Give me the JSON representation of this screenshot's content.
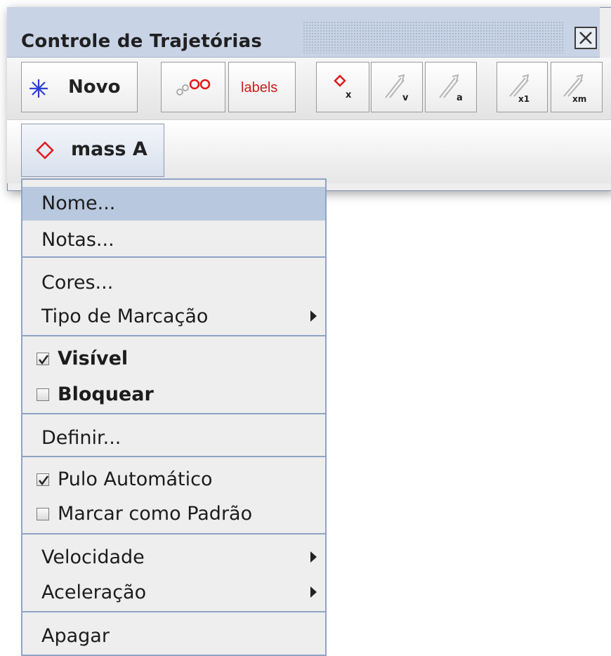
{
  "window": {
    "title": "Controle de Trajetórias",
    "close_icon": "close-icon"
  },
  "toolbar": {
    "new_label": "Novo",
    "new_icon": "asterisk-icon",
    "labels_label": "labels",
    "buttons": [
      {
        "icon": "track-points-icon"
      },
      {
        "icon": "labels-icon"
      },
      {
        "icon": "position-x-icon",
        "subscript": "x"
      },
      {
        "icon": "velocity-vector-icon",
        "subscript": "v"
      },
      {
        "icon": "acceleration-vector-icon",
        "subscript": "a"
      },
      {
        "icon": "vector-x1-icon",
        "subscript": "x1"
      },
      {
        "icon": "vector-xm-icon",
        "subscript": "xm"
      }
    ]
  },
  "track": {
    "label": "mass A",
    "icon": "diamond-icon",
    "color": "#e01a1a"
  },
  "menu": {
    "items": [
      {
        "label": "Nome...",
        "highlighted": true
      },
      {
        "label": "Notas..."
      },
      {
        "label": "Cores..."
      },
      {
        "label": "Tipo de Marcação",
        "submenu": true
      },
      {
        "label": "Visível",
        "checked": true
      },
      {
        "label": "Bloquear",
        "checked": false
      },
      {
        "label": "Definir..."
      },
      {
        "label": "Pulo Automático",
        "checked": true
      },
      {
        "label": "Marcar como Padrão",
        "checked": false
      },
      {
        "label": "Velocidade",
        "submenu": true
      },
      {
        "label": "Aceleração",
        "submenu": true
      },
      {
        "label": "Apagar"
      }
    ]
  },
  "colors": {
    "accent_red": "#e01a1a",
    "new_icon_blue": "#2b3fd6",
    "menu_highlight": "#b8c8de",
    "menu_border": "#8fa3c4"
  }
}
